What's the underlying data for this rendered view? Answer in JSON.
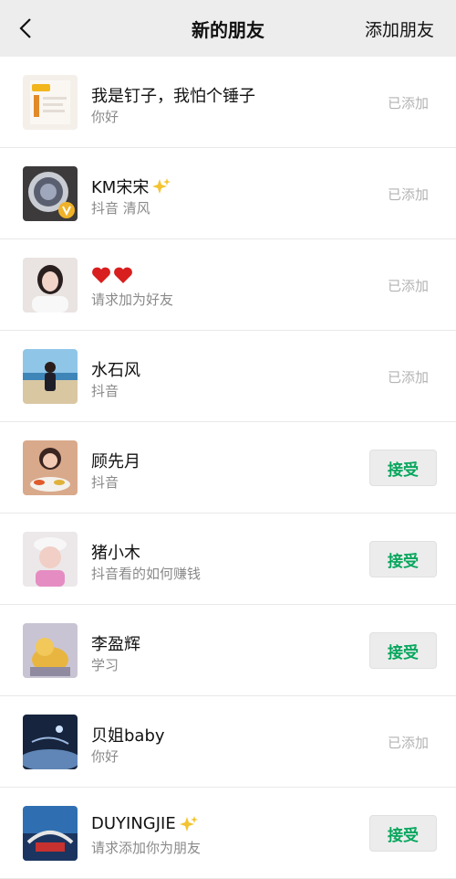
{
  "header": {
    "title": "新的朋友",
    "add_friend_label": "添加朋友"
  },
  "colors": {
    "header_bg": "#ededed",
    "accept_text": "#07a65d",
    "added_text": "#b3b3b3"
  },
  "items": [
    {
      "name": "我是钉子，我怕个锤子",
      "message": "你好",
      "status": "已添加",
      "action": null
    },
    {
      "name": "KM宋宋",
      "message": "抖音 清风",
      "status": "已添加",
      "action": null,
      "icon": "sparkle-emoji"
    },
    {
      "name": "",
      "message": "请求加为好友",
      "status": "已添加",
      "action": null,
      "icon": "two-hearts-emoji"
    },
    {
      "name": "水石风",
      "message": "抖音",
      "status": "已添加",
      "action": null
    },
    {
      "name": "顾先月",
      "message": "抖音",
      "status": null,
      "action": "接受"
    },
    {
      "name": "猪小木",
      "message": "抖音看的如何赚钱",
      "status": null,
      "action": "接受"
    },
    {
      "name": "李盈辉",
      "message": "学习",
      "status": null,
      "action": "接受"
    },
    {
      "name": "贝姐baby",
      "message": "你好",
      "status": "已添加",
      "action": null
    },
    {
      "name": "DUYINGJIE",
      "message": "请求添加你为朋友",
      "status": null,
      "action": "接受",
      "icon": "sparkle-emoji"
    }
  ]
}
